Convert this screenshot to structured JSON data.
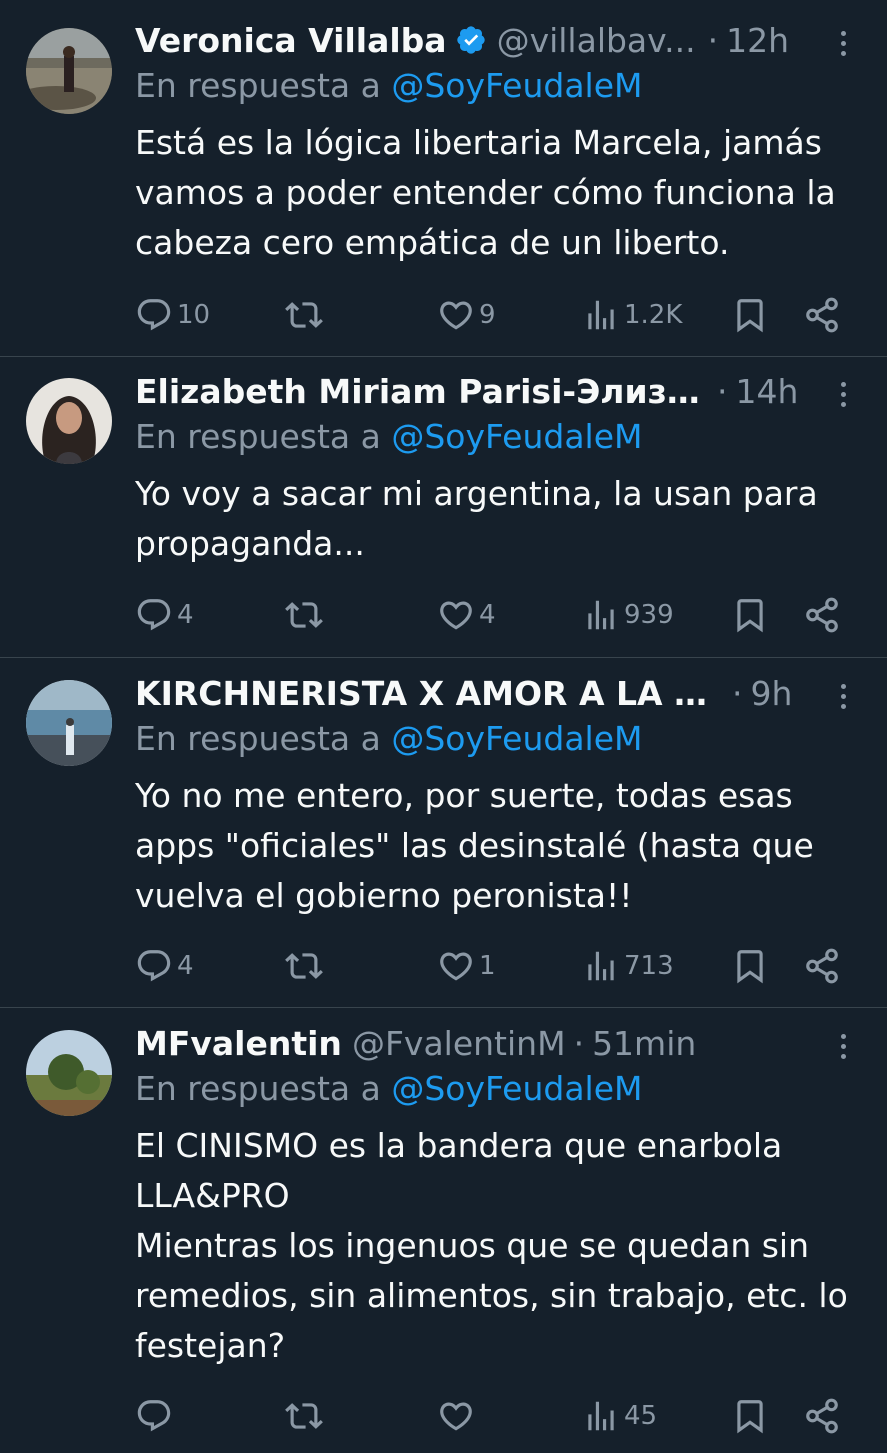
{
  "colors": {
    "background": "#15202b",
    "text": "#f7f9f9",
    "muted": "#8b98a5",
    "accent": "#1d9bf0",
    "divider": "#38444d"
  },
  "tweets": [
    {
      "name": "Veronica Villalba",
      "verified": true,
      "handle": "@villalbav...",
      "time": "12h",
      "reply_prefix": "En respuesta a",
      "reply_to": "@SoyFeudaleM",
      "text": "Está es la lógica libertaria Marcela, jamás vamos a poder entender cómo funciona la cabeza cero empática de un liberto.",
      "replies": "10",
      "retweets": "",
      "likes": "9",
      "views": "1.2K"
    },
    {
      "name": "Elizabeth Miriam Parisi-Элиза...",
      "verified": false,
      "handle": "",
      "time": "14h",
      "reply_prefix": "En respuesta a",
      "reply_to": "@SoyFeudaleM",
      "text": "Yo voy a sacar mi argentina, la usan para propaganda...",
      "replies": "4",
      "retweets": "",
      "likes": "4",
      "views": "939"
    },
    {
      "name": "KIRCHNERISTA X AMOR A LA P...",
      "verified": false,
      "handle": "",
      "time": "9h",
      "reply_prefix": "En respuesta a",
      "reply_to": "@SoyFeudaleM",
      "text": "Yo no me entero, por suerte, todas esas apps \"oficiales\" las desinstalé (hasta que vuelva el gobierno peronista!!",
      "replies": "4",
      "retweets": "",
      "likes": "1",
      "views": "713"
    },
    {
      "name": "MFvalentin",
      "verified": false,
      "handle": "@FvalentinM",
      "time": "51min",
      "reply_prefix": "En respuesta a",
      "reply_to": "@SoyFeudaleM",
      "text": "El CINISMO es la bandera que enarbola LLA&PRO",
      "text2": "Mientras los ingenuos que se quedan sin remedios, sin alimentos, sin trabajo, etc. lo festejan?",
      "replies": "",
      "retweets": "",
      "likes": "",
      "views": "45"
    }
  ]
}
